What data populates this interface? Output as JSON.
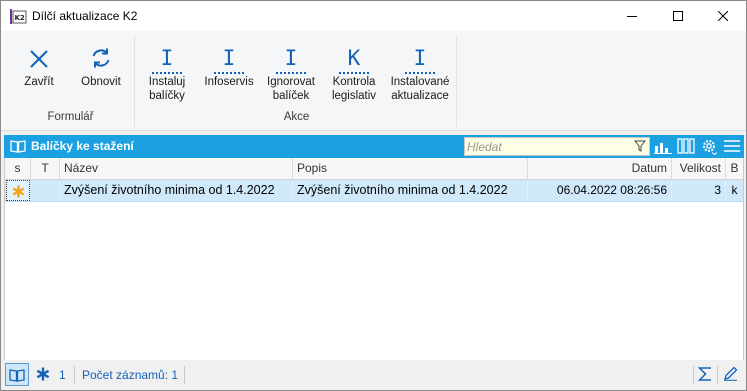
{
  "window": {
    "title": "Dílčí aktualizace K2",
    "icon": "k2-app-icon"
  },
  "ribbon": {
    "groups": [
      {
        "label": "Formulář",
        "buttons": [
          {
            "label": "Zavřít",
            "icon": "close-x-icon"
          },
          {
            "label": "Obnovit",
            "icon": "refresh-icon"
          }
        ]
      },
      {
        "label": "Akce",
        "buttons": [
          {
            "line1": "Instaluj",
            "line2": "balíčky",
            "icon_glyph": "I"
          },
          {
            "line1": "Infoservis",
            "line2": "",
            "icon_glyph": "I"
          },
          {
            "line1": "Ignorovat",
            "line2": "balíček",
            "icon_glyph": "I"
          },
          {
            "line1": "Kontrola",
            "line2": "legislativ",
            "icon_glyph": "K"
          },
          {
            "line1": "Instalované",
            "line2": "aktualizace",
            "icon_glyph": "I"
          }
        ]
      }
    ]
  },
  "panel": {
    "title": "Balíčky ke stažení",
    "search_placeholder": "Hledat"
  },
  "grid": {
    "columns": [
      "s",
      "T",
      "Název",
      "Popis",
      "Datum",
      "Velikost",
      "B"
    ],
    "rows": [
      {
        "s": "*",
        "t": "",
        "nazev": "Zvýšení životního minima od 1.4.2022",
        "popis": "Zvýšení životního minima od 1.4.2022",
        "datum": "06.04.2022 08:26:56",
        "velikost": "3",
        "b": "k"
      }
    ]
  },
  "statusbar": {
    "marked_count": "1",
    "record_count_text": "Počet záznamů: 1"
  },
  "colors": {
    "accent": "#1ba1e2",
    "selected_row": "#cfe9fa",
    "icon_blue": "#1462b8",
    "star_orange": "#f7a21b"
  }
}
